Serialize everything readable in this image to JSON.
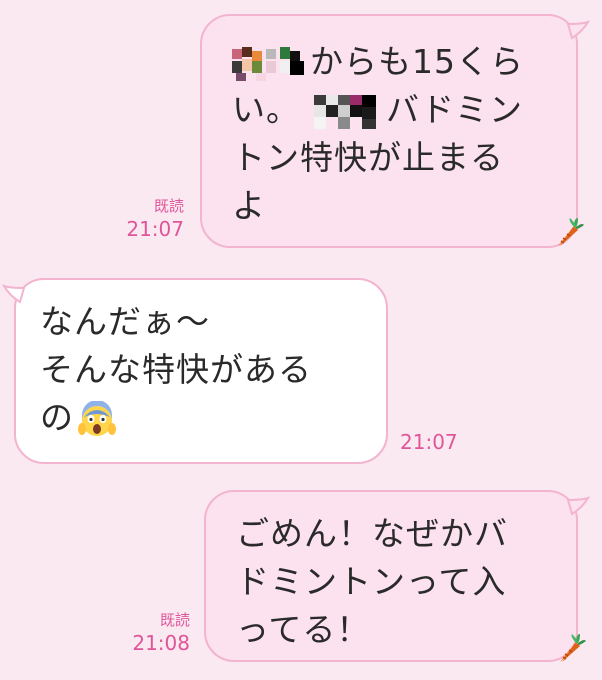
{
  "messages": [
    {
      "side": "sent",
      "lines": [
        "からも15くら",
        "い。",
        "バドミン",
        "トン特快が止まる",
        "よ"
      ],
      "read": "既読",
      "time": "21:07"
    },
    {
      "side": "received",
      "lines": [
        "なんだぁ〜",
        "そんな特快がある",
        "の"
      ],
      "time": "21:07",
      "emoji": "screaming-face-icon"
    },
    {
      "side": "sent",
      "lines": [
        "ごめん！なぜかバ",
        "ドミントンって入",
        "ってる！"
      ],
      "read": "既読",
      "time": "21:08"
    }
  ],
  "colors": {
    "background": "#fbe9f1",
    "sent_bubble": "#fce2ee",
    "received_bubble": "#ffffff",
    "border": "#f2b4cf",
    "meta_text": "#e0559a"
  },
  "icons": {
    "sticker": "carrot-icon",
    "redaction": "pixelated-mosaic"
  }
}
